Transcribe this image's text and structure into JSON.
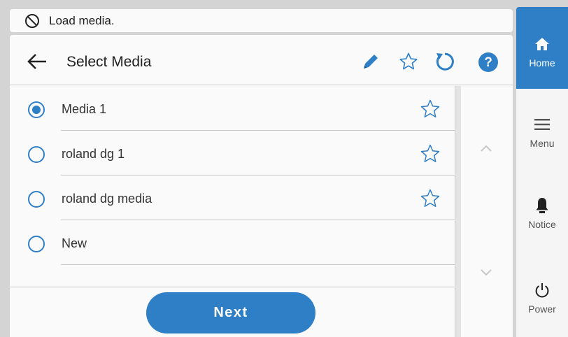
{
  "notice": {
    "icon": "no-entry-icon",
    "text": "Load media."
  },
  "header": {
    "title": "Select Media",
    "icons": [
      "back-arrow-icon",
      "pencil-icon",
      "star-icon",
      "refresh-icon",
      "help-icon"
    ]
  },
  "media_list": [
    {
      "label": "Media 1",
      "selected": true,
      "favorite_icon": "star-icon"
    },
    {
      "label": "roland dg 1",
      "selected": false,
      "favorite_icon": "star-icon"
    },
    {
      "label": "roland dg media",
      "selected": false,
      "favorite_icon": "star-icon"
    },
    {
      "label": "New",
      "selected": false,
      "favorite_icon": null
    }
  ],
  "footer": {
    "next_label": "Next"
  },
  "side_nav": [
    {
      "label": "Home",
      "icon": "home-icon",
      "active": true
    },
    {
      "label": "Menu",
      "icon": "menu-icon",
      "active": false
    },
    {
      "label": "Notice",
      "icon": "bell-icon",
      "active": false
    },
    {
      "label": "Power",
      "icon": "power-icon",
      "active": false
    }
  ],
  "colors": {
    "accent": "#2f7fc7",
    "background": "#d4d4d4",
    "panel": "#fafafa",
    "icon_muted": "#c8c8c8"
  }
}
